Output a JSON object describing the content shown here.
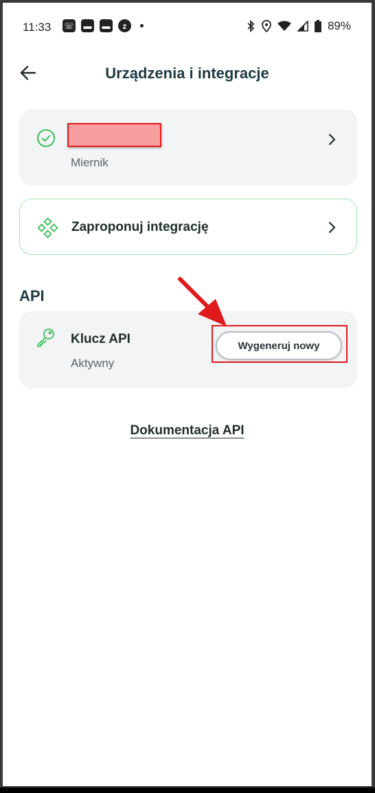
{
  "status_bar": {
    "time": "11:33",
    "battery": "89%",
    "notification_icons": [
      "call-notification-icon",
      "mail-icon",
      "mail-icon",
      "z-app-icon",
      "dot-icon"
    ],
    "system_icons": [
      "bluetooth-icon",
      "location-icon",
      "wifi-icon",
      "signal-icon",
      "battery-icon"
    ]
  },
  "header": {
    "title": "Urządzenia i integracje",
    "back_icon": "arrow-left-icon"
  },
  "device_card": {
    "name_redacted": true,
    "subtitle": "Miernik",
    "status_icon": "check-circle-icon",
    "accent": "#3cbf5a"
  },
  "propose_card": {
    "label": "Zaproponuj integrację",
    "icon": "integration-icon"
  },
  "api_section": {
    "label": "API",
    "key": {
      "label": "Klucz API",
      "status": "Aktywny",
      "icon": "key-icon",
      "button_label": "Wygeneruj nowy"
    }
  },
  "docs_link": "Dokumentacja API",
  "annotation": {
    "color": "#e0191c"
  }
}
